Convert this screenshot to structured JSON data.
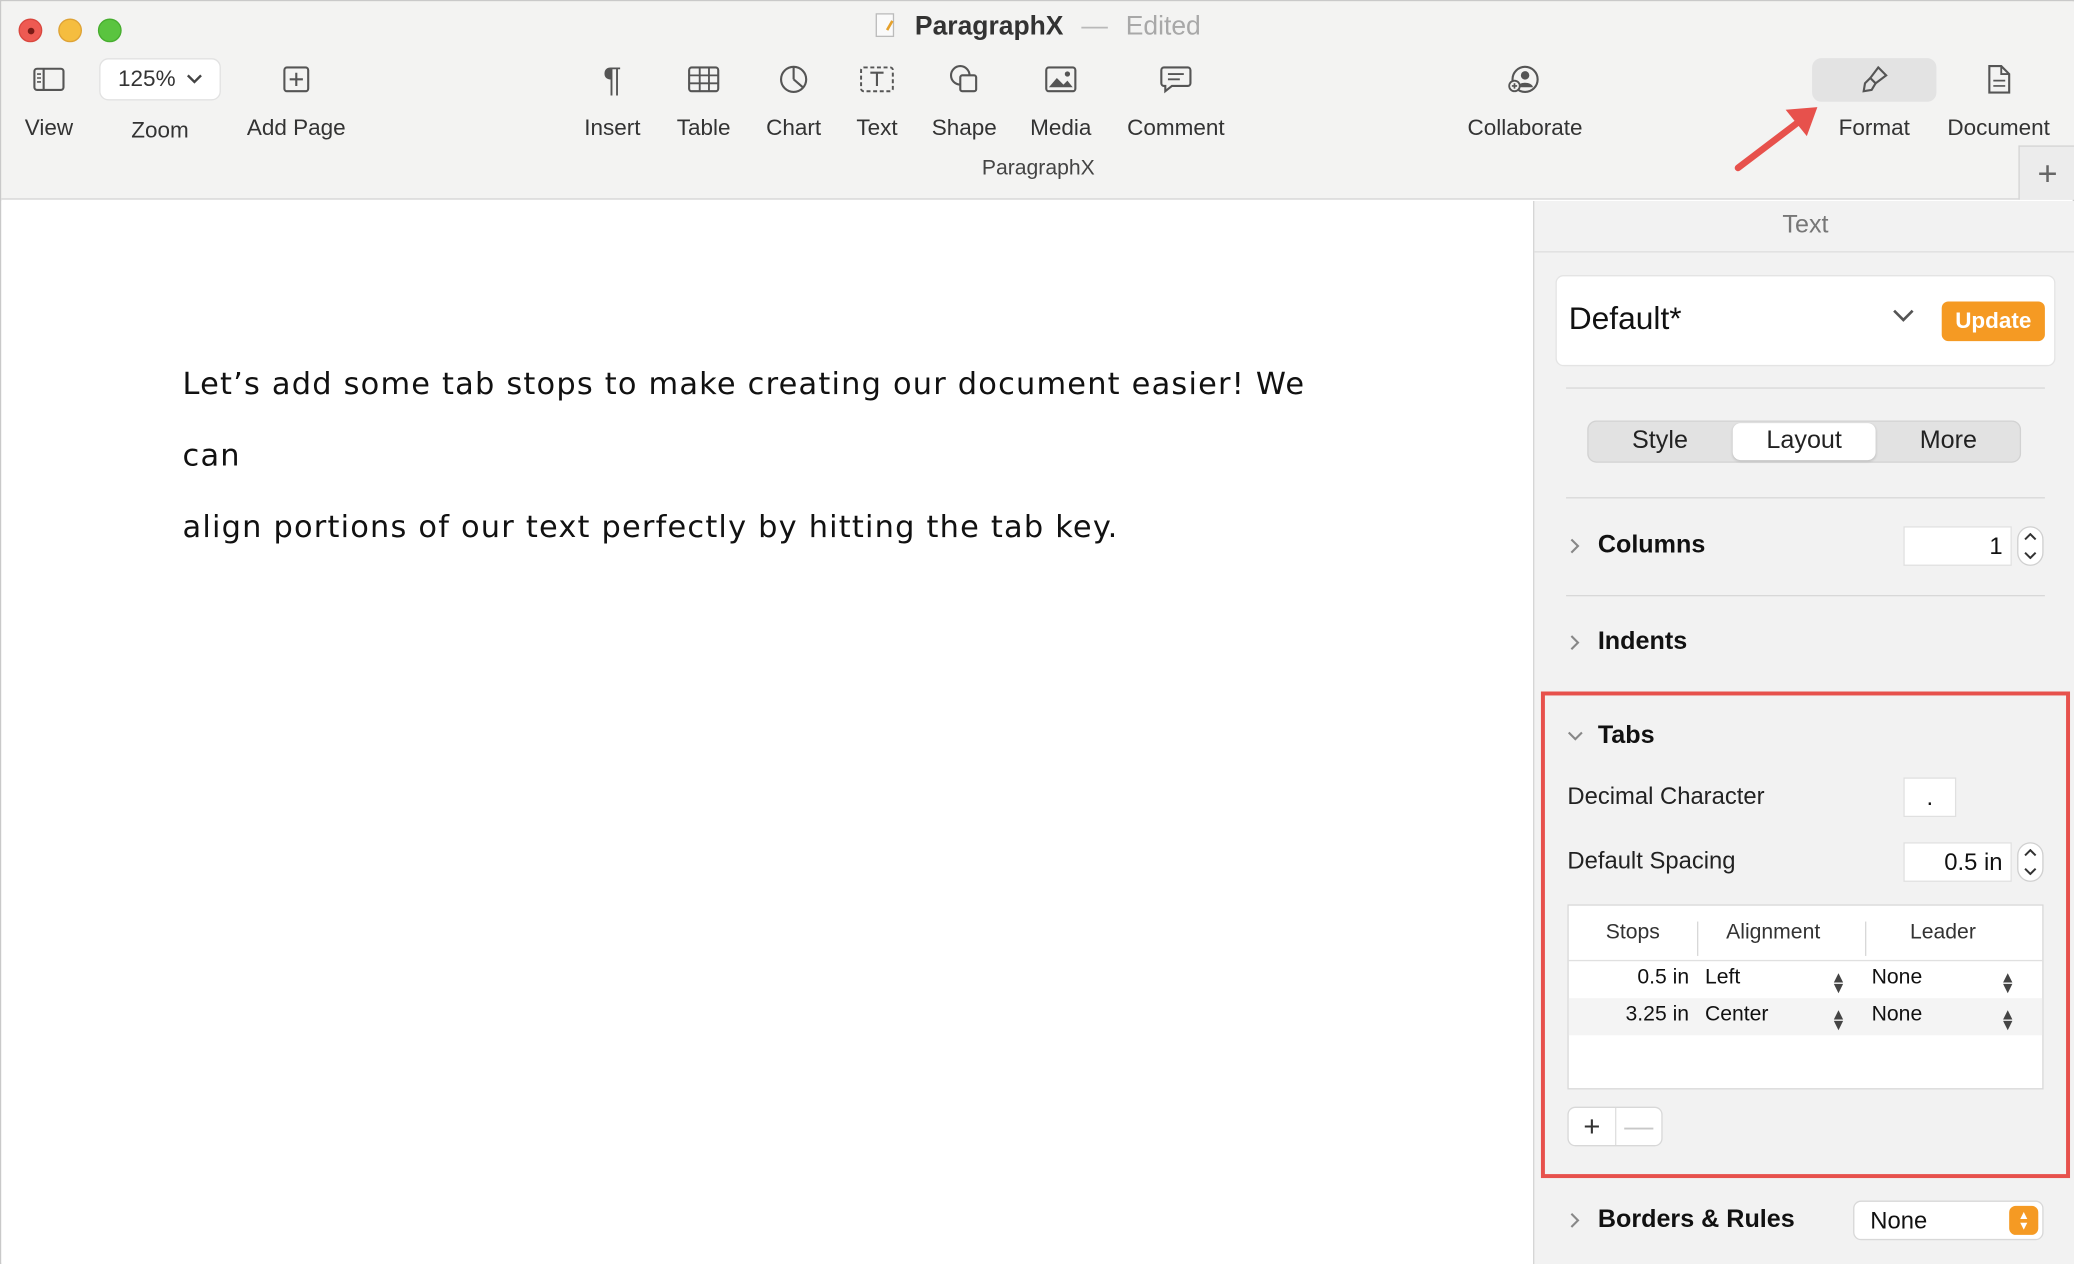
{
  "window": {
    "doc_title": "ParagraphX",
    "separator": "—",
    "status": "Edited",
    "subtitle": "ParagraphX"
  },
  "toolbar": {
    "view": "View",
    "zoom_value": "125%",
    "zoom": "Zoom",
    "add_page": "Add Page",
    "insert": "Insert",
    "table": "Table",
    "chart": "Chart",
    "text": "Text",
    "shape": "Shape",
    "media": "Media",
    "comment": "Comment",
    "collaborate": "Collaborate",
    "format": "Format",
    "document": "Document",
    "add_tab": "+"
  },
  "document": {
    "line1": "Let’s add some tab stops to make creating our document easier! We can",
    "line2": "align portions of our text perfectly by hitting the tab key."
  },
  "inspector": {
    "header": "Text",
    "paragraph_style": "Default*",
    "update_button": "Update",
    "segments": [
      "Style",
      "Layout",
      "More"
    ],
    "active_segment": "Layout",
    "columns_label": "Columns",
    "columns_value": "1",
    "indents_label": "Indents",
    "tabs_label": "Tabs",
    "decimal_char_label": "Decimal Character",
    "decimal_char_value": ".",
    "default_spacing_label": "Default Spacing",
    "default_spacing_value": "0.5 in",
    "table_headers": [
      "Stops",
      "Alignment",
      "Leader"
    ],
    "tab_stops": [
      {
        "stop": "0.5 in",
        "alignment": "Left",
        "leader": "None"
      },
      {
        "stop": "3.25 in",
        "alignment": "Center",
        "leader": "None"
      }
    ],
    "add_stop": "+",
    "remove_stop": "—",
    "borders_label": "Borders & Rules",
    "borders_value": "None"
  },
  "colors": {
    "accent_orange": "#f59a23",
    "highlight_red": "#e7514c"
  }
}
